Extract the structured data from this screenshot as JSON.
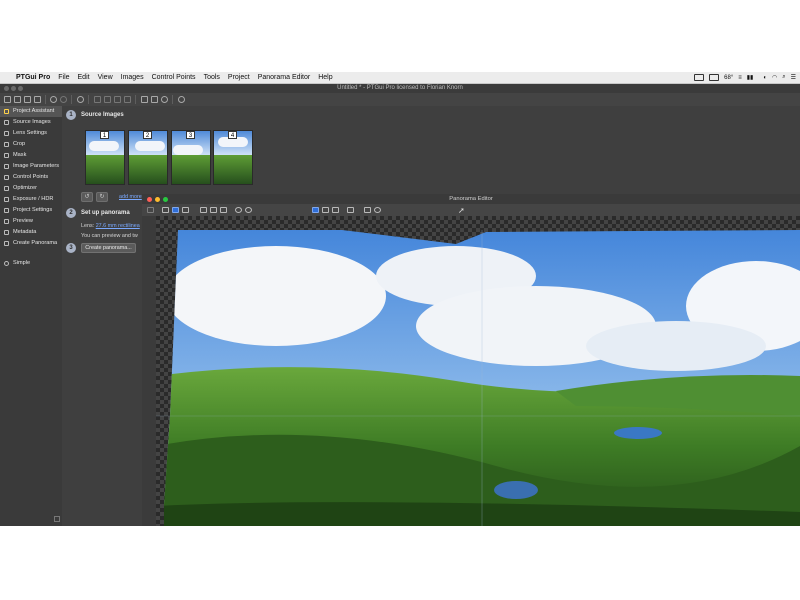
{
  "menubar": {
    "app_name": "PTGui Pro",
    "items": [
      "File",
      "Edit",
      "View",
      "Images",
      "Control Points",
      "Tools",
      "Project",
      "Panorama Editor",
      "Help"
    ],
    "temperature": "68°",
    "battery": "99%"
  },
  "window": {
    "title": "Untitled * - PTGui Pro licensed to Florian Knorn"
  },
  "sidebar": {
    "items": [
      {
        "label": "Project Assistant",
        "icon": "home-icon"
      },
      {
        "label": "Source Images",
        "icon": "images-icon"
      },
      {
        "label": "Lens Settings",
        "icon": "lens-icon"
      },
      {
        "label": "Crop",
        "icon": "crop-icon"
      },
      {
        "label": "Mask",
        "icon": "mask-icon"
      },
      {
        "label": "Image Parameters",
        "icon": "parameters-icon"
      },
      {
        "label": "Control Points",
        "icon": "control-points-icon"
      },
      {
        "label": "Optimizer",
        "icon": "optimizer-icon"
      },
      {
        "label": "Exposure / HDR",
        "icon": "exposure-icon"
      },
      {
        "label": "Project Settings",
        "icon": "settings-icon"
      },
      {
        "label": "Preview",
        "icon": "preview-icon"
      },
      {
        "label": "Metadata",
        "icon": "metadata-icon"
      },
      {
        "label": "Create Panorama",
        "icon": "create-icon"
      }
    ],
    "simple_label": "Simple"
  },
  "assistant": {
    "step1": {
      "num": "1",
      "title": "Source Images"
    },
    "thumbnails": [
      "1",
      "2",
      "3",
      "4"
    ],
    "add_more": "add more",
    "step2": {
      "num": "2",
      "title": "Set up panorama"
    },
    "lens_label": "Lens:",
    "lens_value": "27.6 mm rectilinea",
    "preview_text": "You can preview and tw",
    "step3": {
      "num": "3"
    },
    "create_button": "Create panorama..."
  },
  "panorama_editor": {
    "title": "Panorama Editor"
  },
  "colors": {
    "selected_tool": "#2f6ed8",
    "sidebar_active": "#ffd34a"
  }
}
